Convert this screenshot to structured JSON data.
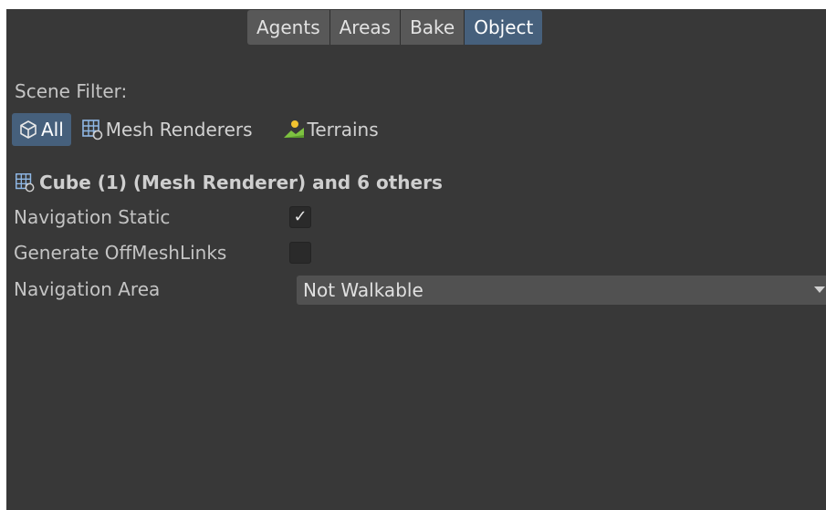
{
  "tabs": [
    {
      "label": "Agents",
      "active": false
    },
    {
      "label": "Areas",
      "active": false
    },
    {
      "label": "Bake",
      "active": false
    },
    {
      "label": "Object",
      "active": true
    }
  ],
  "scene_filter": {
    "label": "Scene Filter:",
    "options": [
      {
        "label": "All",
        "icon": "cube-icon",
        "active": true
      },
      {
        "label": "Mesh Renderers",
        "icon": "mesh-renderer-icon",
        "active": false
      },
      {
        "label": "Terrains",
        "icon": "terrain-icon",
        "active": false
      }
    ]
  },
  "selection": {
    "title": "Cube (1) (Mesh Renderer) and 6 others",
    "icon": "mesh-renderer-icon"
  },
  "fields": {
    "navigation_static": {
      "label": "Navigation Static",
      "checked": true,
      "check_glyph": "✓"
    },
    "generate_offmeshlinks": {
      "label": "Generate OffMeshLinks",
      "checked": false
    },
    "navigation_area": {
      "label": "Navigation Area",
      "value": "Not Walkable"
    }
  },
  "colors": {
    "background": "#383838",
    "tab": "#585858",
    "accent": "#46607c",
    "dropdown": "#515151",
    "checkbox": "#2a2a2a",
    "terrain_green": "#7ec241",
    "terrain_yellow": "#f2c230"
  }
}
